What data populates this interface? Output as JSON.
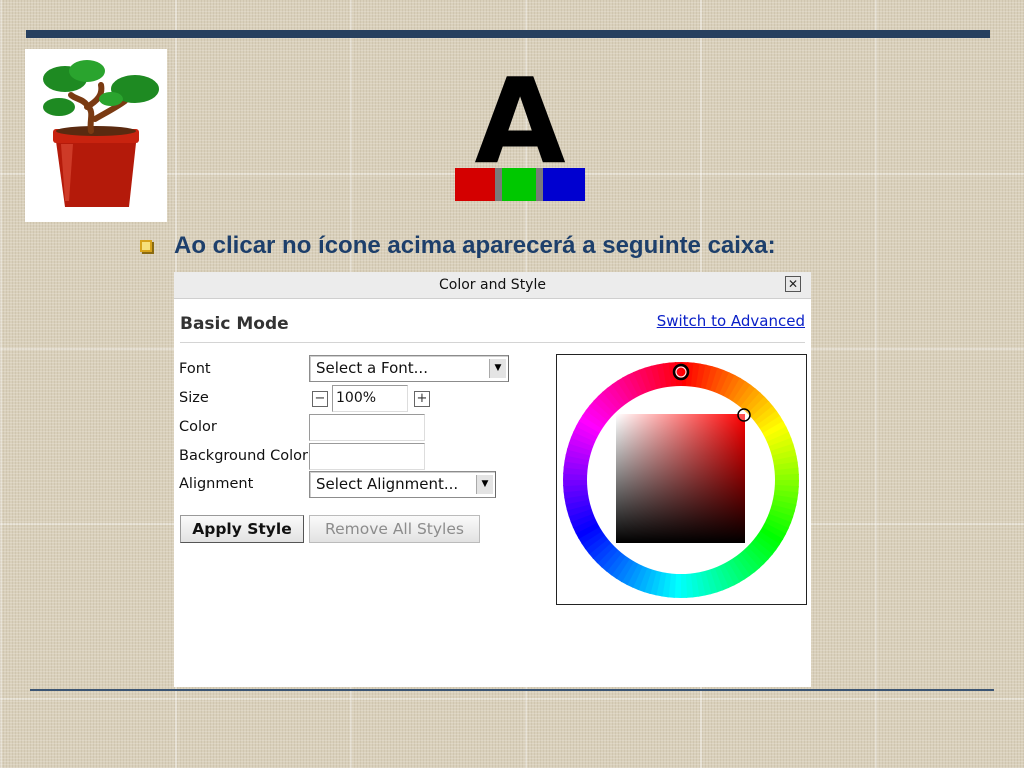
{
  "slide": {
    "bullet_text": "Ao clicar no ícone acima aparecerá a seguinte caixa:",
    "font_icon_letter": "A",
    "font_icon_colors": [
      "#d40000",
      "#00c800",
      "#0000d0"
    ],
    "logo": "bonsai-tree-icon",
    "accent_color": "#27405f"
  },
  "dialog": {
    "title": "Color and Style",
    "close_label": "✕",
    "mode_label": "Basic Mode",
    "switch_link": "Switch to Advanced",
    "font": {
      "label": "Font",
      "value": "Select a Font..."
    },
    "size": {
      "label": "Size",
      "value": "100%",
      "minus": "−",
      "plus": "+"
    },
    "color": {
      "label": "Color",
      "value": ""
    },
    "background_color": {
      "label": "Background Color",
      "value": ""
    },
    "alignment": {
      "label": "Alignment",
      "value": "Select Alignment..."
    },
    "apply_button": "Apply Style",
    "remove_button": "Remove All Styles",
    "picker": {
      "selected_hue_color": "#ff0000"
    }
  }
}
